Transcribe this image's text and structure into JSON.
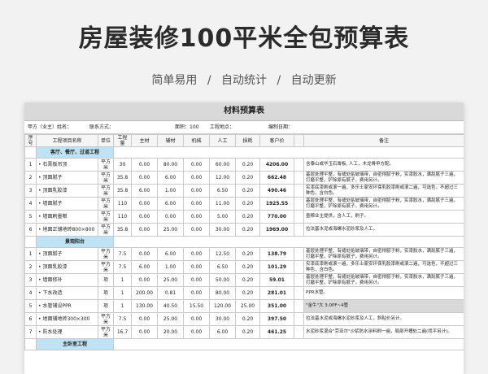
{
  "hero": {
    "title": "房屋装修100平米全包预算表",
    "tags": [
      "简单易用",
      "自动统计",
      "自动更新"
    ],
    "separator": "/"
  },
  "sheet": {
    "title": "材料预算表",
    "info": {
      "owner": "甲方（业主）姓名：",
      "contact": "联系方式：",
      "area": "面积：100",
      "site": "工程地点：",
      "date": "编制日期："
    },
    "headers": [
      "序号",
      "工程项目名称",
      "单位",
      "工程量",
      "主材",
      "辅材",
      "机械",
      "人工",
      "损耗",
      "客户价",
      "",
      "备注"
    ],
    "sections": [
      {
        "name": "客厅、餐厅、过道工程",
        "rows": [
          {
            "no": "1",
            "name": "• 石膏板吊顶",
            "unit": "平方米",
            "qty": "30",
            "main": "0.00",
            "aux": "80.00",
            "mach": "0.00",
            "labor": "60.00",
            "loss": "0.20",
            "price": "4206.00",
            "note": "含泰山或华玉石膏板, 人工，木龙骨甲方配。"
          },
          {
            "no": "2",
            "name": "• 顶面腻子",
            "unit": "平方米",
            "qty": "35.8",
            "main": "0.00",
            "aux": "6.00",
            "mach": "0.00",
            "labor": "12.00",
            "loss": "0.20",
            "price": "662.48",
            "note": "基层处理平整，有缝处贴玻璃带，自密得腻子粉，实漆胶水，满刮腻子三遍，打磨平整，铲除原有腻子，费用另计。"
          },
          {
            "no": "3",
            "name": "• 顶面乳胶漆",
            "unit": "平方米",
            "qty": "35.8",
            "main": "6.00",
            "aux": "1.00",
            "mach": "0.00",
            "labor": "6.50",
            "loss": "0.20",
            "price": "490.46",
            "note": "实漆底漆刷或滚一遍，多乐士家安环保乳胶漆刷或滚二遍，可选色，不超过三种色，含白色。"
          },
          {
            "no": "4",
            "name": "• 墙面腻子",
            "unit": "平方米",
            "qty": "110",
            "main": "0.00",
            "aux": "6.00",
            "mach": "0.00",
            "labor": "11.00",
            "loss": "0.20",
            "price": "1925.55",
            "note": "基层处理平整，有缝处贴玻璃带，自密得腻子粉，实漆胶水，满刮腻子三遍，打磨平整，铲除原有腻子，费用另计。"
          },
          {
            "no": "5",
            "name": "• 墙面刷墨粮",
            "unit": "平方米",
            "qty": "110",
            "main": "0.00",
            "aux": "0.00",
            "mach": "0.00",
            "labor": "5.00",
            "loss": "0.20",
            "price": "770.00",
            "note": "墨粮业主提供，含人工，刷子。"
          },
          {
            "no": "6",
            "name": "• 地面正铺地砖800×800",
            "unit": "平方米",
            "qty": "35.8",
            "main": "0.00",
            "aux": "25.00",
            "mach": "0.00",
            "labor": "30.00",
            "loss": "0.20",
            "price": "1969.00",
            "note": "拉法基水泥或海螺水泥砂浆及人工。"
          }
        ]
      },
      {
        "name": "景观阳台",
        "rows": [
          {
            "no": "1",
            "name": "• 顶面腻子",
            "unit": "平方米",
            "qty": "7.5",
            "main": "0.00",
            "aux": "6.00",
            "mach": "0.00",
            "labor": "12.50",
            "loss": "0.20",
            "price": "138.79",
            "note": "基层处理平整，有缝处贴玻璃带，自密得腻子粉，实漆胶水，满刮腻子三遍，打磨平整，铲除原有腻子，费用另计。"
          },
          {
            "no": "2",
            "name": "• 顶面乳胶漆",
            "unit": "平方米",
            "qty": "7.5",
            "main": "6.00",
            "aux": "1.00",
            "mach": "0.00",
            "labor": "6.50",
            "loss": "0.20",
            "price": "101.29",
            "note": "实漆底漆刷或滚一遍，多乐士家安环保乳胶漆刷或滚二遍，可选色，不超过三种色，含白色。"
          },
          {
            "no": "3",
            "name": "• 墙面修补",
            "unit": "项",
            "qty": "1",
            "main": "0.00",
            "aux": "25.00",
            "mach": "0.00",
            "labor": "50.00",
            "loss": "0.20",
            "price": "59.01",
            "note": "基层处理平整，有缝处贴玻璃带，自密得腻子粉，实漆胶水，满刮腻子三遍，打磨平整，铲除原有腻子，费用另计。"
          },
          {
            "no": "4",
            "name": "• 下水改造",
            "unit": "项",
            "qty": "1",
            "main": "200.00",
            "aux": "0.81",
            "mach": "0.00",
            "labor": "80.00",
            "loss": "0.20",
            "price": "281.01",
            "note": "PPR水管。"
          },
          {
            "no": "5",
            "name": "• 水管铺设PPR",
            "unit": "项",
            "qty": "1",
            "main": "130.00",
            "aux": "40.50",
            "mach": "15.50",
            "labor": "120.00",
            "loss": "25.00",
            "price": "351.00",
            "note": "\"金牛\"大 3.0PF~4管",
            "hl": true
          },
          {
            "no": "6",
            "name": "• 地面铺地砖300×300",
            "unit": "平方米",
            "qty": "7.5",
            "main": "0.00",
            "aux": "25.00",
            "mach": "0.00",
            "labor": "30.00",
            "loss": "0.20",
            "price": "397.50",
            "note": "拉法基水泥或海螺水泥砂浆及人工，斜贴价另计。"
          },
          {
            "no": "7",
            "name": "• 防水处理",
            "unit": "平方米",
            "qty": "16.7",
            "main": "0.00",
            "aux": "20.00",
            "mach": "0.00",
            "labor": "6.00",
            "loss": "0.20",
            "price": "461.25",
            "note": "水泥砂浆混合\"劳亚尔\"沙浆防水涂料刷一遍，局部开槽处二遍(找平另计)。"
          }
        ]
      },
      {
        "name": "主卧室工程",
        "rows": []
      }
    ]
  }
}
